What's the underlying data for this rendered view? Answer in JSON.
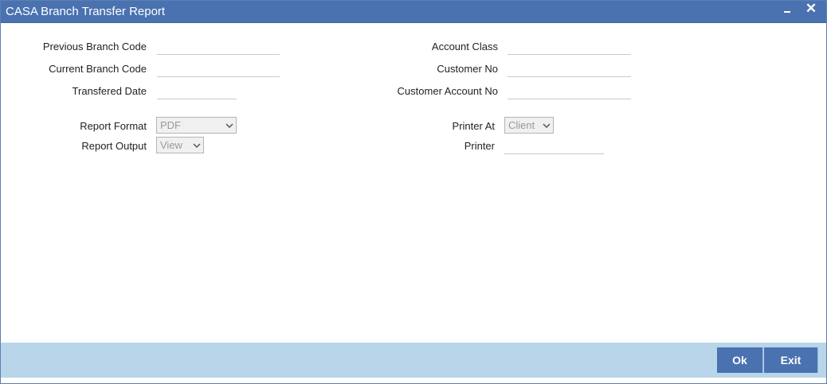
{
  "window": {
    "title": "CASA Branch Transfer Report"
  },
  "form": {
    "previous_branch_code": {
      "label": "Previous Branch Code",
      "value": ""
    },
    "current_branch_code": {
      "label": "Current Branch Code",
      "value": ""
    },
    "transfered_date": {
      "label": "Transfered Date",
      "value": ""
    },
    "account_class": {
      "label": "Account Class",
      "value": ""
    },
    "customer_no": {
      "label": "Customer No",
      "value": ""
    },
    "customer_account_no": {
      "label": "Customer Account No",
      "value": ""
    },
    "report_format": {
      "label": "Report Format",
      "selected": "PDF"
    },
    "report_output": {
      "label": "Report Output",
      "selected": "View"
    },
    "printer_at": {
      "label": "Printer At",
      "selected": "Client"
    },
    "printer": {
      "label": "Printer",
      "value": ""
    }
  },
  "footer": {
    "ok_label": "Ok",
    "exit_label": "Exit"
  },
  "icons": {
    "minimize": "minimize-icon",
    "close": "close-icon",
    "dropdown": "chevron-down-icon"
  },
  "colors": {
    "titlebar": "#4a72b0",
    "footer": "#b8d5ea",
    "button": "#4a72b0"
  }
}
